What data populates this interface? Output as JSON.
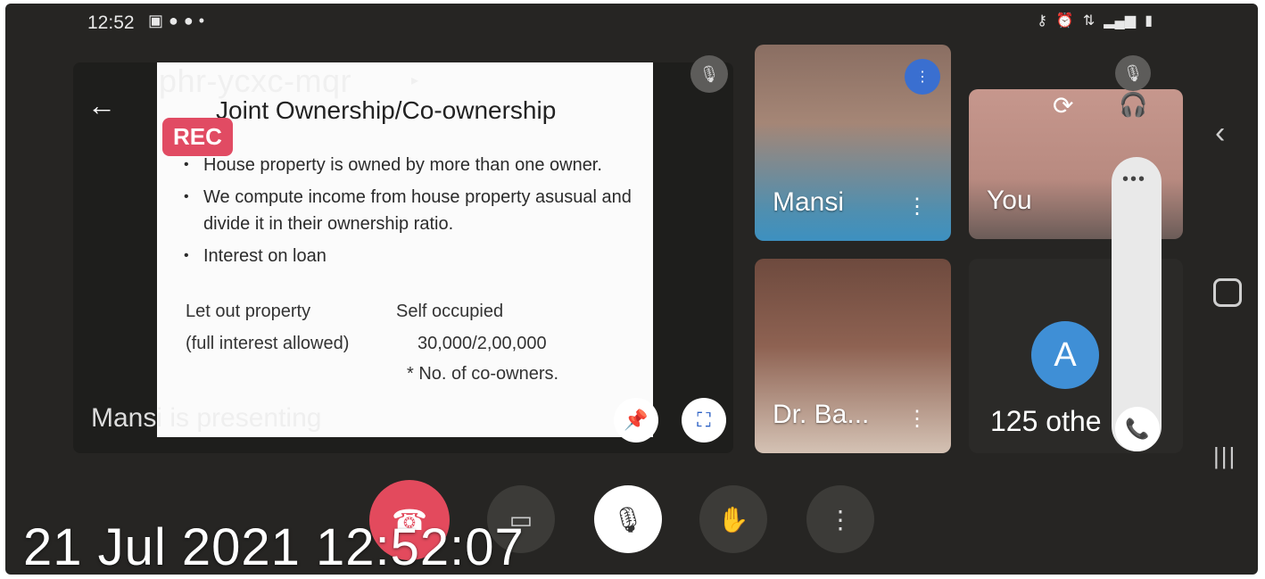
{
  "status_bar": {
    "time": "12:52",
    "left_icons": [
      "image-icon",
      "whatsapp-icon",
      "phone-icon",
      "dot-icon"
    ],
    "right_icons": [
      "key-icon",
      "alarm-icon",
      "data-icon",
      "signal-icon",
      "battery-icon"
    ]
  },
  "meeting": {
    "code": "phr-ycxc-mqr",
    "rec_label": "REC",
    "presenting_text": "Mansi is presenting"
  },
  "slide": {
    "title": "Joint Ownership/Co-ownership",
    "bullets": [
      "House property is owned by more than one owner.",
      "We compute income from house property asusual and divide it in their ownership ratio.",
      "Interest on loan"
    ],
    "row1_left": "Let out property",
    "row1_right": "Self occupied",
    "row2_left": "(full interest allowed)",
    "row2_right": "30,000/2,00,000",
    "row3_right": "* No. of co-owners."
  },
  "participants": {
    "mansi": {
      "name": "Mansi"
    },
    "you": {
      "name": "You"
    },
    "dr": {
      "name": "Dr. Ba..."
    },
    "others": {
      "avatar_letter": "A",
      "label": "125 othe"
    }
  },
  "timestamp": "21 Jul 2021 12:52:07",
  "colors": {
    "rec": "#e14b63",
    "end_call": "#e34a5d",
    "avatar": "#3f8fd6",
    "accent": "#2a5fc4"
  }
}
